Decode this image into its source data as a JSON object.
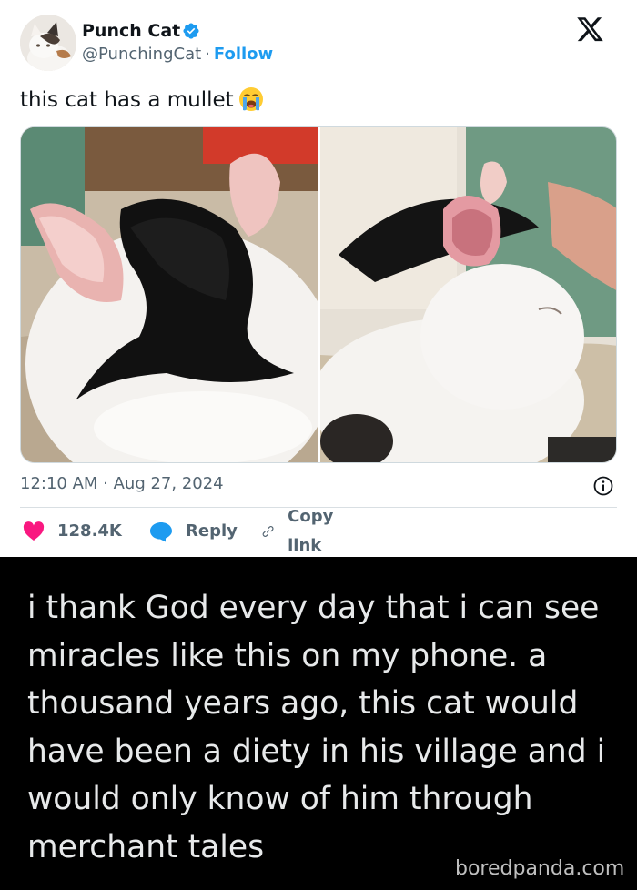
{
  "author": {
    "name": "Punch Cat",
    "handle": "@PunchingCat",
    "separator": "·",
    "follow_label": "Follow",
    "verified": true,
    "avatar_icon": "cat-avatar"
  },
  "header": {
    "logo_icon": "x-logo-icon"
  },
  "tweet": {
    "text": "this cat has a mullet",
    "emoji_icon": "loudly-crying-face-icon",
    "media": [
      {
        "name": "cat-back-of-head-photo"
      },
      {
        "name": "cat-side-profile-photo"
      }
    ],
    "timestamp": "12:10 AM · Aug 27, 2024"
  },
  "actions": {
    "likes": "128.4K",
    "reply_label": "Reply",
    "copy_label": "Copy link"
  },
  "quote": {
    "text": "i thank God every day that i can see miracles like this on my phone. a thousand years ago, this cat would have been a diety in his village and i would only know of him through merchant tales"
  },
  "watermark": "boredpanda.com",
  "colors": {
    "accent": "#1d9bf0",
    "like": "#f91880",
    "text": "#0f1419",
    "muted": "#536471",
    "panel": "#000000"
  }
}
